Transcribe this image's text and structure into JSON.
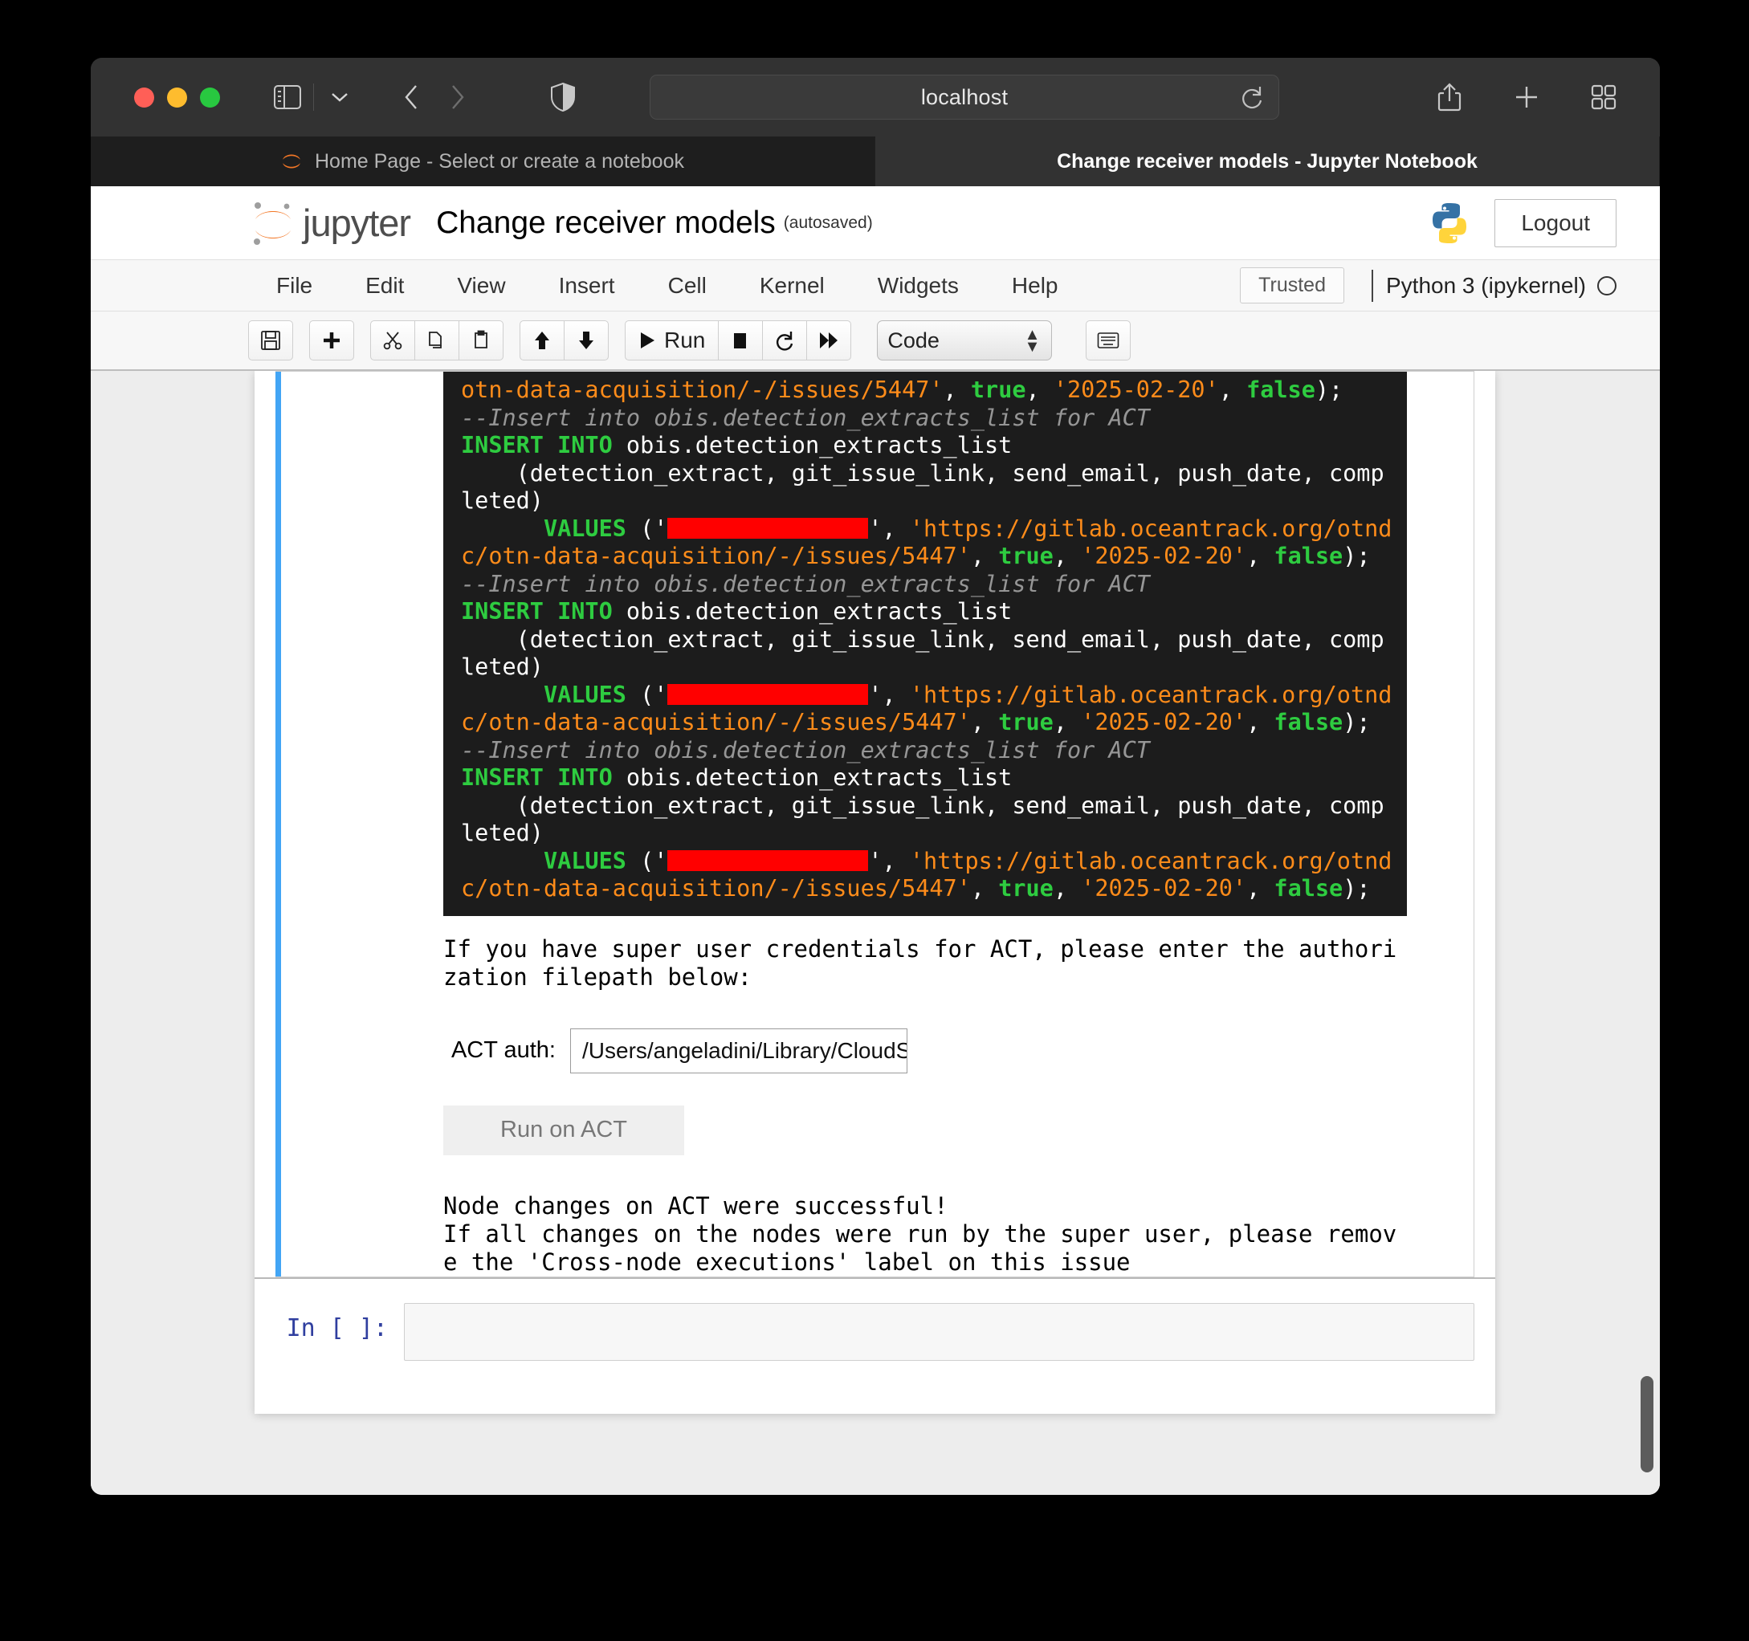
{
  "browser": {
    "url": "localhost",
    "traffic_lights": [
      "close",
      "minimize",
      "maximize"
    ],
    "icons": {
      "sidebar": "sidebar-toggle-icon",
      "sidebar_dropdown": "chevron-down-icon",
      "back": "back-arrow-icon",
      "forward": "forward-arrow-icon",
      "shield": "privacy-shield-icon",
      "reload": "reload-icon",
      "share": "share-icon",
      "new_tab": "plus-icon",
      "tab_overview": "tab-overview-icon"
    },
    "tabs": [
      {
        "title": "Home Page - Select or create a notebook",
        "active": false
      },
      {
        "title": "Change receiver models - Jupyter Notebook",
        "active": true
      }
    ]
  },
  "jupyter": {
    "brand": "jupyter",
    "notebook_title": "Change receiver models",
    "autosave_label": "(autosaved)",
    "logout_label": "Logout",
    "trusted_label": "Trusted",
    "kernel_label": "Python 3 (ipykernel)",
    "menus": [
      "File",
      "Edit",
      "View",
      "Insert",
      "Cell",
      "Kernel",
      "Widgets",
      "Help"
    ],
    "toolbar": {
      "save": "save-icon",
      "add": "plus-icon",
      "cut": "scissors-icon",
      "copy": "copy-icon",
      "paste": "paste-icon",
      "move_up": "arrow-up-icon",
      "move_down": "arrow-down-icon",
      "run_label": "Run",
      "stop": "stop-icon",
      "restart": "restart-icon",
      "restart_run_all": "fast-forward-icon",
      "cell_type": "Code",
      "keyboard": "keyboard-icon"
    }
  },
  "cell_output": {
    "lines": [
      [
        {
          "t": "otn-data-acquisition/-/issues/5447'",
          "c": "k-orange"
        },
        {
          "t": ", ",
          "c": "k-plain"
        },
        {
          "t": "true",
          "c": "k-green"
        },
        {
          "t": ", ",
          "c": "k-plain"
        },
        {
          "t": "'2025-02-20'",
          "c": "k-orange"
        },
        {
          "t": ", ",
          "c": "k-plain"
        },
        {
          "t": "false",
          "c": "k-green"
        },
        {
          "t": ");",
          "c": "k-plain"
        }
      ],
      [
        {
          "t": "--Insert into obis.detection_extracts_list for ACT",
          "c": "k-comment"
        }
      ],
      [
        {
          "t": "INSERT INTO",
          "c": "k-green"
        },
        {
          "t": " obis.detection_extracts_list",
          "c": "k-plain"
        }
      ],
      [
        {
          "t": "    (detection_extract, git_issue_link, send_email, push_date, completed)",
          "c": "k-plain"
        }
      ],
      [
        {
          "t": "      ",
          "c": "k-plain"
        },
        {
          "t": "VALUES",
          "c": "k-green"
        },
        {
          "t": " ('",
          "c": "k-plain"
        },
        {
          "t": "",
          "c": "redact"
        },
        {
          "t": "', ",
          "c": "k-plain"
        },
        {
          "t": "'https://gitlab.oceantrack.org/otndc/otn-data-acquisition/-/issues/5447'",
          "c": "k-orange"
        },
        {
          "t": ", ",
          "c": "k-plain"
        },
        {
          "t": "true",
          "c": "k-green"
        },
        {
          "t": ", ",
          "c": "k-plain"
        },
        {
          "t": "'2025-02-20'",
          "c": "k-orange"
        },
        {
          "t": ", ",
          "c": "k-plain"
        },
        {
          "t": "false",
          "c": "k-green"
        },
        {
          "t": ");",
          "c": "k-plain"
        }
      ],
      [
        {
          "t": "--Insert into obis.detection_extracts_list for ACT",
          "c": "k-comment"
        }
      ],
      [
        {
          "t": "INSERT INTO",
          "c": "k-green"
        },
        {
          "t": " obis.detection_extracts_list",
          "c": "k-plain"
        }
      ],
      [
        {
          "t": "    (detection_extract, git_issue_link, send_email, push_date, completed)",
          "c": "k-plain"
        }
      ],
      [
        {
          "t": "      ",
          "c": "k-plain"
        },
        {
          "t": "VALUES",
          "c": "k-green"
        },
        {
          "t": " ('",
          "c": "k-plain"
        },
        {
          "t": "",
          "c": "redact"
        },
        {
          "t": "', ",
          "c": "k-plain"
        },
        {
          "t": "'https://gitlab.oceantrack.org/otndc/otn-data-acquisition/-/issues/5447'",
          "c": "k-orange"
        },
        {
          "t": ", ",
          "c": "k-plain"
        },
        {
          "t": "true",
          "c": "k-green"
        },
        {
          "t": ", ",
          "c": "k-plain"
        },
        {
          "t": "'2025-02-20'",
          "c": "k-orange"
        },
        {
          "t": ", ",
          "c": "k-plain"
        },
        {
          "t": "false",
          "c": "k-green"
        },
        {
          "t": ");",
          "c": "k-plain"
        }
      ],
      [
        {
          "t": "--Insert into obis.detection_extracts_list for ACT",
          "c": "k-comment"
        }
      ],
      [
        {
          "t": "INSERT INTO",
          "c": "k-green"
        },
        {
          "t": " obis.detection_extracts_list",
          "c": "k-plain"
        }
      ],
      [
        {
          "t": "    (detection_extract, git_issue_link, send_email, push_date, completed)",
          "c": "k-plain"
        }
      ],
      [
        {
          "t": "      ",
          "c": "k-plain"
        },
        {
          "t": "VALUES",
          "c": "k-green"
        },
        {
          "t": " ('",
          "c": "k-plain"
        },
        {
          "t": "",
          "c": "redact"
        },
        {
          "t": "', ",
          "c": "k-plain"
        },
        {
          "t": "'https://gitlab.oceantrack.org/otndc/otn-data-acquisition/-/issues/5447'",
          "c": "k-orange"
        },
        {
          "t": ", ",
          "c": "k-plain"
        },
        {
          "t": "true",
          "c": "k-green"
        },
        {
          "t": ", ",
          "c": "k-plain"
        },
        {
          "t": "'2025-02-20'",
          "c": "k-orange"
        },
        {
          "t": ", ",
          "c": "k-plain"
        },
        {
          "t": "false",
          "c": "k-green"
        },
        {
          "t": ");",
          "c": "k-plain"
        }
      ]
    ]
  },
  "widgets": {
    "prompt_text": "If you have super user credentials for ACT, please enter the authorization filepath below:",
    "auth_label": "ACT auth:",
    "auth_value": "/Users/angeladini/Library/CloudS",
    "run_button_label": "Run on ACT",
    "status_text": "Node changes on ACT were successful!\nIf all changes on the nodes were run by the super user, please remove the 'Cross-node executions' label on this issue"
  },
  "input_cell": {
    "prompt": "In [ ]:",
    "value": ""
  },
  "colors": {
    "cell_selected_bar": "#42a5f5",
    "terminal_bg": "#1c1c1c",
    "keyword_green": "#2ecc40",
    "string_orange": "#ff8c1a",
    "comment_gray": "#969696",
    "redaction_red": "#ff0000",
    "prompt_blue": "#303f9f"
  }
}
